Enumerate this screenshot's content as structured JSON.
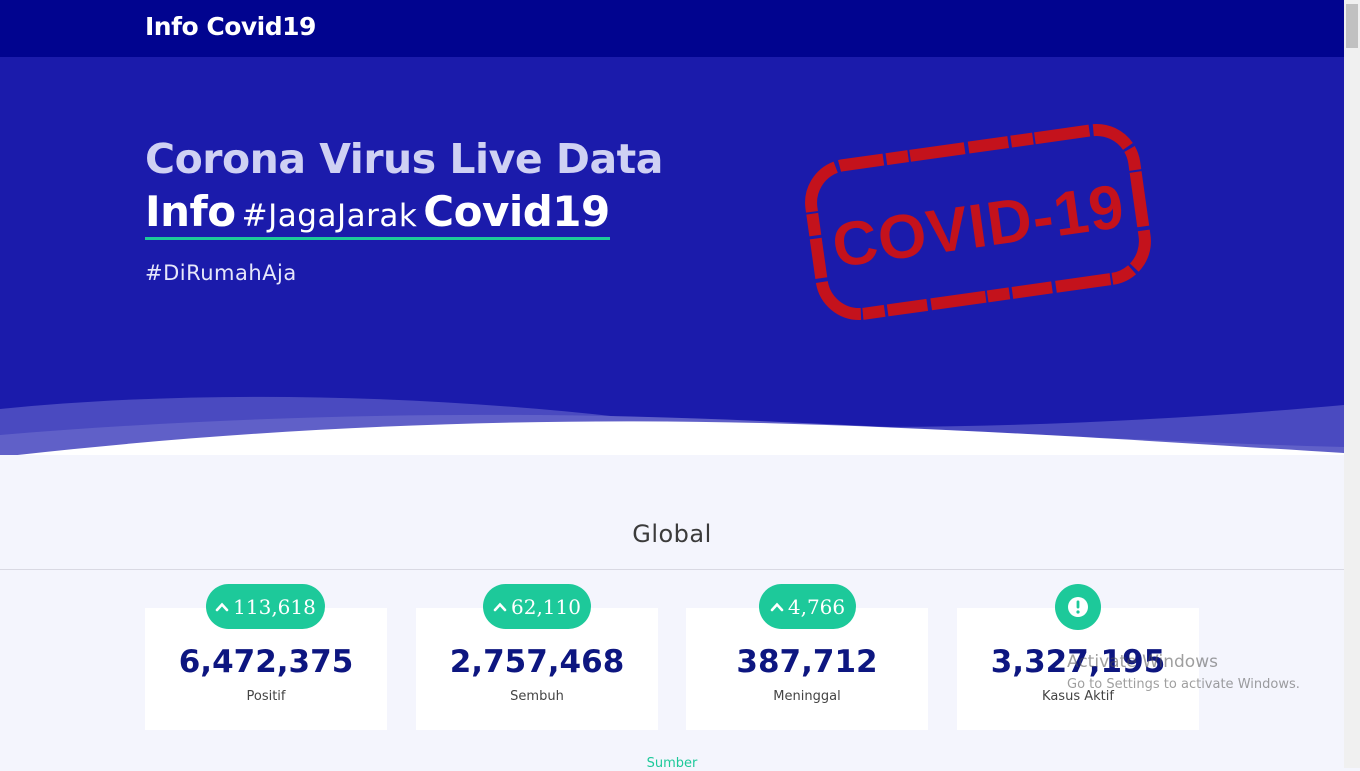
{
  "navbar": {
    "brand": "Info Covid19"
  },
  "hero": {
    "line1": "Corona Virus Live Data",
    "line2_start": "Info",
    "line2_hashtag": "#JagaJarak",
    "line2_end": "Covid19",
    "subtitle": "#DiRumahAja",
    "stamp_text": "COVID-19"
  },
  "section": {
    "title": "Global"
  },
  "stats": [
    {
      "value": "6,472,375",
      "label": "Positif",
      "delta": "113,618"
    },
    {
      "value": "2,757,468",
      "label": "Sembuh",
      "delta": "62,110"
    },
    {
      "value": "387,712",
      "label": "Meninggal",
      "delta": "4,766"
    },
    {
      "value": "3,327,195",
      "label": "Kasus Aktif",
      "icon": "exclamation-icon"
    }
  ],
  "source_label": "Sumber",
  "watermark": {
    "title": "Activate Windows",
    "subtitle": "Go to Settings to activate Windows."
  },
  "colors": {
    "navbar": "#01048f",
    "hero": "#1b1bab",
    "accent": "#1dc99a",
    "value": "#0d1680",
    "stamp": "#c4121c"
  }
}
